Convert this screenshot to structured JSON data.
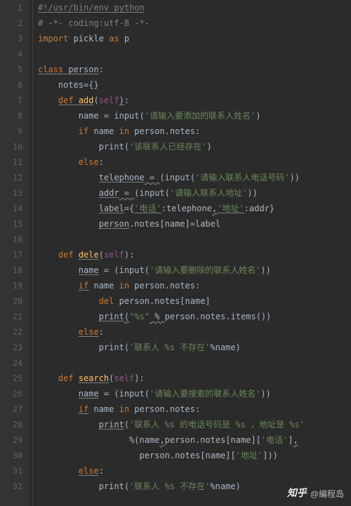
{
  "watermark": {
    "logo": "知乎",
    "author": "@编程岛"
  },
  "lines": [
    {
      "n": 1,
      "tokens": [
        {
          "t": "#!/usr/bin/env python",
          "c": "cm ul"
        }
      ]
    },
    {
      "n": 2,
      "tokens": [
        {
          "t": "# -*- coding:utf-8 -*-",
          "c": "cm"
        }
      ]
    },
    {
      "n": 3,
      "tokens": [
        {
          "t": "import ",
          "c": "kw"
        },
        {
          "t": "pickle ",
          "c": "id"
        },
        {
          "t": "as ",
          "c": "kw"
        },
        {
          "t": "p",
          "c": "id"
        }
      ]
    },
    {
      "n": 4,
      "tokens": []
    },
    {
      "n": 5,
      "tokens": [
        {
          "t": "class ",
          "c": "kw ul"
        },
        {
          "t": "person",
          "c": "id ul"
        },
        {
          "t": ":",
          "c": "op"
        }
      ]
    },
    {
      "n": 6,
      "tokens": [
        {
          "t": "    notes={}",
          "c": "id"
        }
      ]
    },
    {
      "n": 7,
      "tokens": [
        {
          "t": "    ",
          "c": ""
        },
        {
          "t": "def ",
          "c": "kw ul"
        },
        {
          "t": "add",
          "c": "fn ul"
        },
        {
          "t": "(",
          "c": "op"
        },
        {
          "t": "self",
          "c": "sf"
        },
        {
          "t": ")",
          "c": "op ul"
        },
        {
          "t": ":",
          "c": "op"
        }
      ]
    },
    {
      "n": 8,
      "tokens": [
        {
          "t": "        name = ",
          "c": "id"
        },
        {
          "t": "input",
          "c": "id"
        },
        {
          "t": "(",
          "c": "op"
        },
        {
          "t": "'请输入要添加的联系人姓名'",
          "c": "str"
        },
        {
          "t": ")",
          "c": "op"
        }
      ]
    },
    {
      "n": 9,
      "tokens": [
        {
          "t": "        ",
          "c": ""
        },
        {
          "t": "if ",
          "c": "kw"
        },
        {
          "t": "name ",
          "c": "id"
        },
        {
          "t": "in ",
          "c": "kw"
        },
        {
          "t": "person.notes:",
          "c": "id"
        }
      ]
    },
    {
      "n": 10,
      "tokens": [
        {
          "t": "            ",
          "c": ""
        },
        {
          "t": "print",
          "c": "id"
        },
        {
          "t": "(",
          "c": "op"
        },
        {
          "t": "'该联系人已经存在'",
          "c": "str"
        },
        {
          "t": ")",
          "c": "op"
        }
      ]
    },
    {
      "n": 11,
      "tokens": [
        {
          "t": "        ",
          "c": ""
        },
        {
          "t": "else",
          "c": "kw"
        },
        {
          "t": ":",
          "c": "op"
        }
      ]
    },
    {
      "n": 12,
      "tokens": [
        {
          "t": "            ",
          "c": ""
        },
        {
          "t": "telephone",
          "c": "id ul"
        },
        {
          "t": " = ",
          "c": "op ulw"
        },
        {
          "t": "(",
          "c": "op"
        },
        {
          "t": "input",
          "c": "id"
        },
        {
          "t": "(",
          "c": "op"
        },
        {
          "t": "'请输入联系人电话号码'",
          "c": "str"
        },
        {
          "t": "))",
          "c": "op"
        }
      ]
    },
    {
      "n": 13,
      "tokens": [
        {
          "t": "            ",
          "c": ""
        },
        {
          "t": "addr",
          "c": "id ul"
        },
        {
          "t": " = ",
          "c": "op ulw"
        },
        {
          "t": "(",
          "c": "op"
        },
        {
          "t": "input",
          "c": "id"
        },
        {
          "t": "(",
          "c": "op"
        },
        {
          "t": "'请输入联系人地址'",
          "c": "str"
        },
        {
          "t": "))",
          "c": "op"
        }
      ]
    },
    {
      "n": 14,
      "tokens": [
        {
          "t": "            ",
          "c": ""
        },
        {
          "t": "label",
          "c": "id ul"
        },
        {
          "t": "={",
          "c": "op"
        },
        {
          "t": "'电话'",
          "c": "str ul"
        },
        {
          "t": ":telephone",
          "c": "id"
        },
        {
          "t": ",",
          "c": "op ulw"
        },
        {
          "t": "'地址'",
          "c": "str ul"
        },
        {
          "t": ":addr}",
          "c": "id"
        }
      ]
    },
    {
      "n": 15,
      "tokens": [
        {
          "t": "            ",
          "c": ""
        },
        {
          "t": "person",
          "c": "id ul"
        },
        {
          "t": ".notes[name]=label",
          "c": "id"
        }
      ]
    },
    {
      "n": 16,
      "tokens": []
    },
    {
      "n": 17,
      "tokens": [
        {
          "t": "    ",
          "c": ""
        },
        {
          "t": "def ",
          "c": "kw"
        },
        {
          "t": "dele",
          "c": "fn ul"
        },
        {
          "t": "(",
          "c": "op"
        },
        {
          "t": "self",
          "c": "sf"
        },
        {
          "t": "):",
          "c": "op"
        }
      ]
    },
    {
      "n": 18,
      "tokens": [
        {
          "t": "        ",
          "c": ""
        },
        {
          "t": "name",
          "c": "id ul"
        },
        {
          "t": " = (",
          "c": "op"
        },
        {
          "t": "input",
          "c": "id"
        },
        {
          "t": "(",
          "c": "op"
        },
        {
          "t": "'请输入要删除的联系人姓名'",
          "c": "str"
        },
        {
          "t": "))",
          "c": "op"
        }
      ]
    },
    {
      "n": 19,
      "tokens": [
        {
          "t": "        ",
          "c": ""
        },
        {
          "t": "if",
          "c": "kw ul"
        },
        {
          "t": " name ",
          "c": "id"
        },
        {
          "t": "in ",
          "c": "kw"
        },
        {
          "t": "person.notes:",
          "c": "id"
        }
      ]
    },
    {
      "n": 20,
      "tokens": [
        {
          "t": "            ",
          "c": ""
        },
        {
          "t": "del ",
          "c": "kw"
        },
        {
          "t": "person.notes[name]",
          "c": "id"
        }
      ]
    },
    {
      "n": 21,
      "tokens": [
        {
          "t": "            ",
          "c": ""
        },
        {
          "t": "print",
          "c": "id ul"
        },
        {
          "t": "(",
          "c": "op ulw"
        },
        {
          "t": "\"%s\"",
          "c": "str"
        },
        {
          "t": " % ",
          "c": "op ulw"
        },
        {
          "t": "person.notes.items())",
          "c": "id"
        }
      ]
    },
    {
      "n": 22,
      "tokens": [
        {
          "t": "        ",
          "c": ""
        },
        {
          "t": "else",
          "c": "kw ul"
        },
        {
          "t": ":",
          "c": "op"
        }
      ]
    },
    {
      "n": 23,
      "tokens": [
        {
          "t": "            ",
          "c": ""
        },
        {
          "t": "print",
          "c": "id"
        },
        {
          "t": "(",
          "c": "op"
        },
        {
          "t": "'联系人 %s 不存在'",
          "c": "str"
        },
        {
          "t": "%name)",
          "c": "id"
        }
      ]
    },
    {
      "n": 24,
      "tokens": []
    },
    {
      "n": 25,
      "tokens": [
        {
          "t": "    ",
          "c": ""
        },
        {
          "t": "def ",
          "c": "kw"
        },
        {
          "t": "search",
          "c": "fn ul"
        },
        {
          "t": "(",
          "c": "op"
        },
        {
          "t": "self",
          "c": "sf"
        },
        {
          "t": "):",
          "c": "op"
        }
      ]
    },
    {
      "n": 26,
      "tokens": [
        {
          "t": "        ",
          "c": ""
        },
        {
          "t": "name",
          "c": "id ul"
        },
        {
          "t": " = (",
          "c": "op"
        },
        {
          "t": "input",
          "c": "id"
        },
        {
          "t": "(",
          "c": "op"
        },
        {
          "t": "'请输入要搜索的联系人姓名'",
          "c": "str"
        },
        {
          "t": "))",
          "c": "op"
        }
      ]
    },
    {
      "n": 27,
      "tokens": [
        {
          "t": "        ",
          "c": ""
        },
        {
          "t": "if",
          "c": "kw ul"
        },
        {
          "t": " name ",
          "c": "id"
        },
        {
          "t": "in ",
          "c": "kw"
        },
        {
          "t": "person.notes:",
          "c": "id"
        }
      ]
    },
    {
      "n": 28,
      "tokens": [
        {
          "t": "            ",
          "c": ""
        },
        {
          "t": "print",
          "c": "id ul"
        },
        {
          "t": "(",
          "c": "op"
        },
        {
          "t": "'联系人 %s 的电话号码是 %s ，地址是 %s'",
          "c": "str"
        }
      ]
    },
    {
      "n": 29,
      "tokens": [
        {
          "t": "                  %(name",
          "c": "id"
        },
        {
          "t": ",",
          "c": "op ulw"
        },
        {
          "t": "person.notes[name][",
          "c": "id"
        },
        {
          "t": "'电话'",
          "c": "str"
        },
        {
          "t": "]",
          "c": "op"
        },
        {
          "t": ",",
          "c": "op ulw"
        }
      ]
    },
    {
      "n": 30,
      "tokens": [
        {
          "t": "                    person.notes[name][",
          "c": "id"
        },
        {
          "t": "'地址'",
          "c": "str"
        },
        {
          "t": "]))",
          "c": "op"
        }
      ]
    },
    {
      "n": 31,
      "tokens": [
        {
          "t": "        ",
          "c": ""
        },
        {
          "t": "else",
          "c": "kw ul"
        },
        {
          "t": ":",
          "c": "op"
        }
      ]
    },
    {
      "n": 32,
      "tokens": [
        {
          "t": "            ",
          "c": ""
        },
        {
          "t": "print",
          "c": "id"
        },
        {
          "t": "(",
          "c": "op"
        },
        {
          "t": "'联系人 %s 不存在'",
          "c": "str"
        },
        {
          "t": "%name)",
          "c": "id"
        }
      ]
    }
  ]
}
